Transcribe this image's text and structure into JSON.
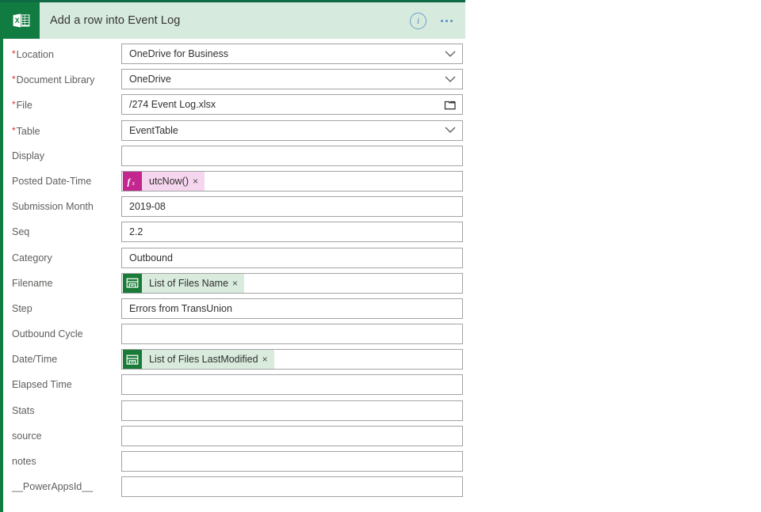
{
  "header": {
    "title": "Add a row into Event Log",
    "app_icon": "excel-icon",
    "info_icon": "info-icon",
    "more_icon": "ellipsis-icon",
    "background_color": "#d7eade",
    "accent_color": "#107c41"
  },
  "colors": {
    "required_asterisk": "#d13438",
    "expression_token_bg": "#f5d6ee",
    "expression_token_icon": "#c3268f",
    "dynamic_token_bg": "#d8ebdd",
    "dynamic_token_icon": "#1a7b38",
    "field_border": "#a3a3a3"
  },
  "fields": [
    {
      "label": "Location",
      "required": true,
      "type": "dropdown",
      "value": "OneDrive for Business",
      "name": "location"
    },
    {
      "label": "Document Library",
      "required": true,
      "type": "dropdown",
      "value": "OneDrive",
      "name": "document-library"
    },
    {
      "label": "File",
      "required": true,
      "type": "file-picker",
      "value": "/274 Event Log.xlsx",
      "name": "file"
    },
    {
      "label": "Table",
      "required": true,
      "type": "dropdown",
      "value": "EventTable",
      "name": "table"
    },
    {
      "label": "Display",
      "required": false,
      "type": "text",
      "value": "",
      "name": "display"
    },
    {
      "label": "Posted Date-Time",
      "required": false,
      "type": "token",
      "value": "",
      "name": "posted-date-time",
      "token": {
        "kind": "expression",
        "icon": "fx-icon",
        "text": "utcNow()",
        "close": "×"
      }
    },
    {
      "label": "Submission Month",
      "required": false,
      "type": "text",
      "value": "2019-08",
      "name": "submission-month"
    },
    {
      "label": "Seq",
      "required": false,
      "type": "text",
      "value": "2.2",
      "name": "seq"
    },
    {
      "label": "Category",
      "required": false,
      "type": "text",
      "value": "Outbound",
      "name": "category"
    },
    {
      "label": "Filename",
      "required": false,
      "type": "token",
      "value": "",
      "name": "filename",
      "token": {
        "kind": "dynamic",
        "icon": "onedrive-file-icon",
        "text": "List of Files Name",
        "close": "×"
      }
    },
    {
      "label": "Step",
      "required": false,
      "type": "text",
      "value": "Errors from TransUnion",
      "name": "step"
    },
    {
      "label": "Outbound Cycle",
      "required": false,
      "type": "text",
      "value": "",
      "name": "outbound-cycle"
    },
    {
      "label": "Date/Time",
      "required": false,
      "type": "token",
      "value": "",
      "name": "date-time",
      "token": {
        "kind": "dynamic",
        "icon": "onedrive-file-icon",
        "text": "List of Files LastModified",
        "close": "×"
      }
    },
    {
      "label": "Elapsed Time",
      "required": false,
      "type": "text",
      "value": "",
      "name": "elapsed-time"
    },
    {
      "label": "Stats",
      "required": false,
      "type": "text",
      "value": "",
      "name": "stats"
    },
    {
      "label": "source",
      "required": false,
      "type": "text",
      "value": "",
      "name": "source"
    },
    {
      "label": "notes",
      "required": false,
      "type": "text",
      "value": "",
      "name": "notes"
    },
    {
      "label": "__PowerAppsId__",
      "required": false,
      "type": "text",
      "value": "",
      "name": "powerappsid"
    }
  ]
}
